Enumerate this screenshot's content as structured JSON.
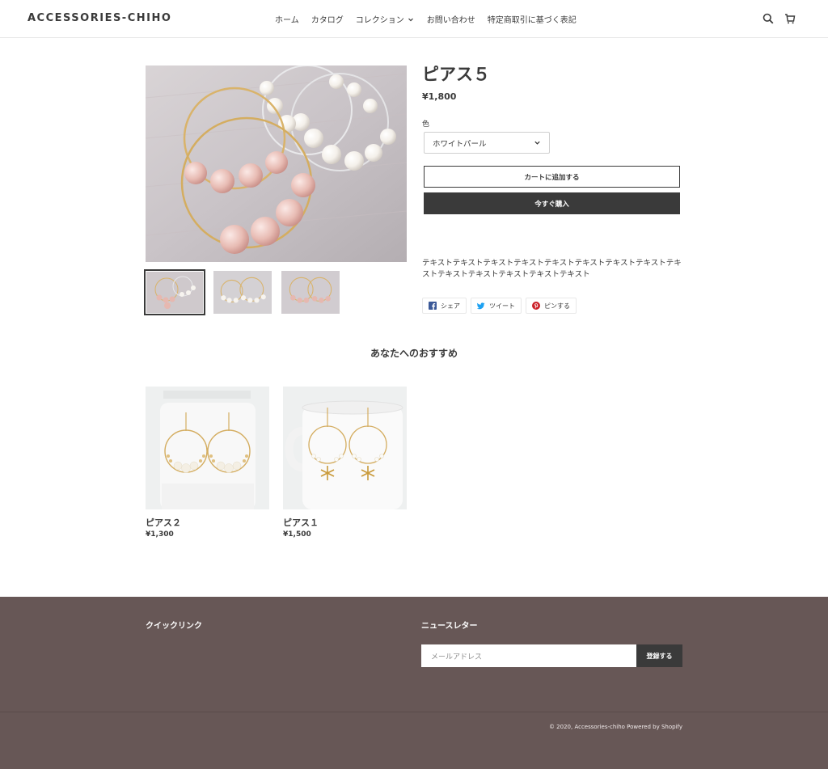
{
  "header": {
    "logo": "ACCESSORIES-CHIHO",
    "nav": [
      {
        "label": "ホーム"
      },
      {
        "label": "カタログ"
      },
      {
        "label": "コレクション",
        "has_dropdown": true
      },
      {
        "label": "お問い合わせ"
      },
      {
        "label": "特定商取引に基づく表記"
      }
    ],
    "icons": [
      "search-icon",
      "cart-icon"
    ]
  },
  "product": {
    "title": "ピアス５",
    "price": "¥1,800",
    "variant_label": "色",
    "variant_selected": "ホワイトパール",
    "add_to_cart": "カートに追加する",
    "buy_now": "今すぐ購入",
    "description": "テキストテキストテキストテキストテキストテキストテキストテキストテキストテキストテキストテキストテキストテキスト",
    "thumbnails": 3,
    "social": {
      "share": "シェア",
      "tweet": "ツイート",
      "pin": "ピンする"
    }
  },
  "recommendations": {
    "title": "あなたへのおすすめ",
    "items": [
      {
        "name": "ピアス２",
        "price": "¥1,300"
      },
      {
        "name": "ピアス１",
        "price": "¥1,500"
      }
    ]
  },
  "footer": {
    "quick_links": "クイックリンク",
    "newsletter_title": "ニュースレター",
    "email_placeholder": "メールアドレス",
    "subscribe": "登録する",
    "copyright": "© 2020, Accessories-chiho Powered by Shopify"
  },
  "colors": {
    "text": "#3a3a3a",
    "footer_bg": "#675756",
    "button_dark": "#3a3a3a"
  }
}
